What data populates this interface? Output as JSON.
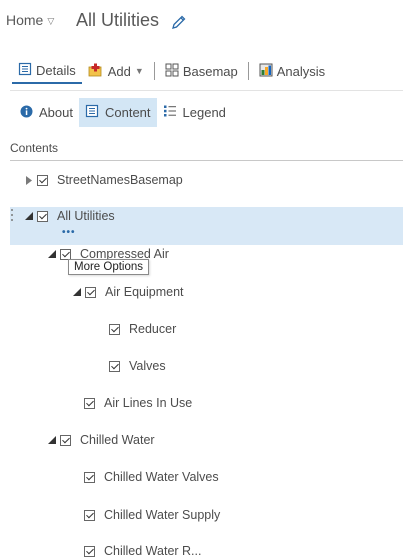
{
  "header": {
    "home_label": "Home",
    "title": "All Utilities"
  },
  "toolbar": {
    "details_label": "Details",
    "add_label": "Add",
    "basemap_label": "Basemap",
    "analysis_label": "Analysis"
  },
  "subtabs": {
    "about_label": "About",
    "content_label": "Content",
    "legend_label": "Legend",
    "active": "Content"
  },
  "contents": {
    "heading": "Contents",
    "tooltip": "More Options",
    "layers": [
      {
        "label": "StreetNamesBasemap",
        "expanded": false,
        "checked": true
      },
      {
        "label": "All Utilities",
        "expanded": true,
        "checked": true,
        "selected": true
      },
      {
        "label": "Compressed Air",
        "expanded": true,
        "checked": true
      },
      {
        "label": "Air Equipment",
        "expanded": true,
        "checked": true
      },
      {
        "label": "Reducer",
        "checked": true
      },
      {
        "label": "Valves",
        "checked": true
      },
      {
        "label": "Air Lines In Use",
        "checked": true
      },
      {
        "label": "Chilled Water",
        "expanded": true,
        "checked": true
      },
      {
        "label": "Chilled Water Valves",
        "checked": true
      },
      {
        "label": "Chilled Water Supply",
        "checked": true
      },
      {
        "label": "Chilled Water R...",
        "checked": true
      }
    ]
  },
  "colors": {
    "selected_background": "#d8e8f6",
    "active_tab_background": "#d3e6f5",
    "accent": "#2b6aa8"
  }
}
